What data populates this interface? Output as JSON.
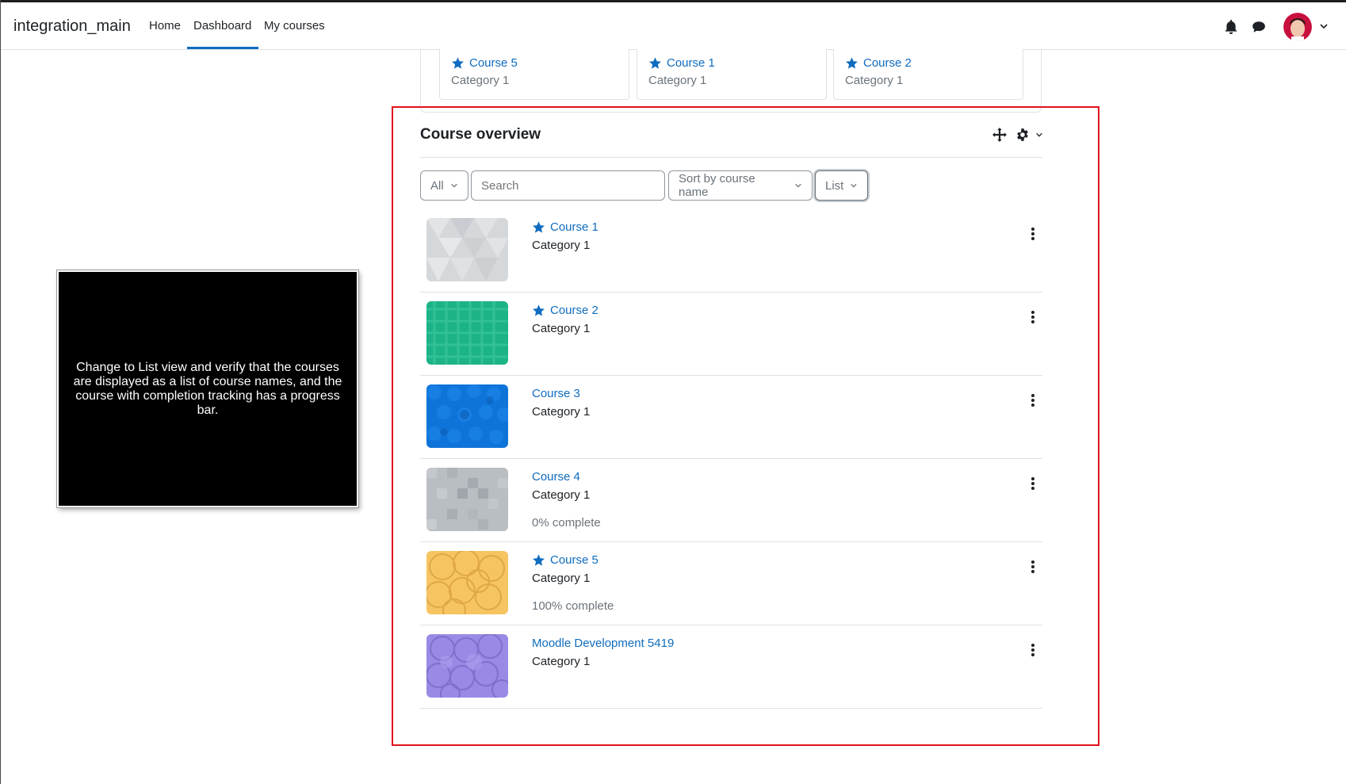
{
  "navbar": {
    "brand": "integration_main",
    "links": [
      "Home",
      "Dashboard",
      "My courses"
    ],
    "active": "Dashboard"
  },
  "starred": [
    {
      "name": "Course 5",
      "category": "Category 1"
    },
    {
      "name": "Course 1",
      "category": "Category 1"
    },
    {
      "name": "Course 2",
      "category": "Category 1"
    }
  ],
  "overview": {
    "title": "Course overview",
    "filter": "All",
    "search_placeholder": "Search",
    "sort": "Sort by course name",
    "view": "List"
  },
  "courses": [
    {
      "name": "Course 1",
      "category": "Category 1",
      "starred": true,
      "progress": ""
    },
    {
      "name": "Course 2",
      "category": "Category 1",
      "starred": true,
      "progress": ""
    },
    {
      "name": "Course 3",
      "category": "Category 1",
      "starred": false,
      "progress": ""
    },
    {
      "name": "Course 4",
      "category": "Category 1",
      "starred": false,
      "progress": "0% complete"
    },
    {
      "name": "Course 5",
      "category": "Category 1",
      "starred": true,
      "progress": "100% complete"
    },
    {
      "name": "Moodle Development 5419",
      "category": "Category 1",
      "starred": false,
      "progress": ""
    }
  ],
  "overlay": {
    "text": "Change to List view and verify that the courses are displayed as a list of course names, and the course with completion tracking has a progress bar."
  },
  "colors": {
    "link": "#0f6cbf",
    "highlight_border": "#e0121b",
    "overlay_bg": "#000000"
  },
  "icons": {
    "bell": "bell-icon",
    "chat": "chat-icon",
    "move": "move-icon",
    "gear": "gear-icon",
    "star": "star-icon",
    "menu": "kebab-menu-icon",
    "caret": "chevron-down-icon"
  }
}
